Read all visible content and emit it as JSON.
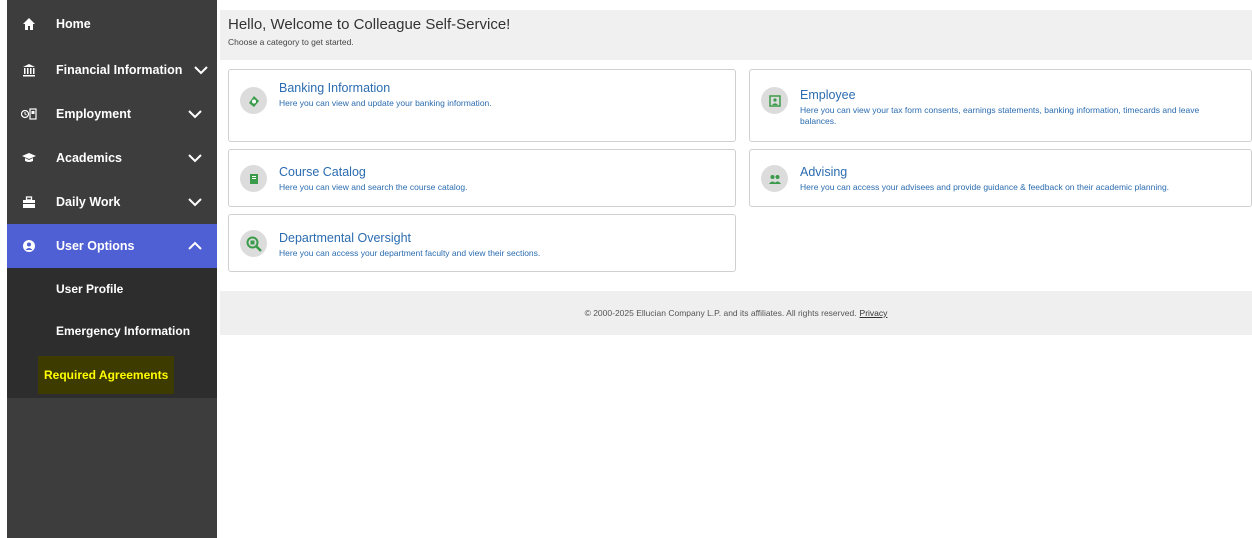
{
  "sidebar": {
    "home": {
      "label": "Home",
      "icon": "home-icon"
    },
    "items": [
      {
        "label": "Financial Information",
        "icon": "bank-icon"
      },
      {
        "label": "Employment",
        "icon": "id-card-icon"
      },
      {
        "label": "Academics",
        "icon": "graduation-cap-icon"
      },
      {
        "label": "Daily Work",
        "icon": "briefcase-icon"
      },
      {
        "label": "User Options",
        "icon": "user-icon"
      }
    ],
    "submenu": [
      {
        "label": "User Profile"
      },
      {
        "label": "Emergency Information"
      },
      {
        "label": "Required Agreements"
      }
    ],
    "active_color": "#4f5fd4",
    "highlight_color": "#ffff00"
  },
  "header": {
    "title": "Hello, Welcome to Colleague Self-Service!",
    "subtitle": "Choose a category to get started."
  },
  "cards": [
    {
      "title": "Banking Information",
      "desc": "Here you can view and update your banking information.",
      "icon": "banking-icon"
    },
    {
      "title": "Employee",
      "desc": "Here you can view your tax form consents, earnings statements, banking information, timecards and leave balances.",
      "icon": "employee-icon"
    },
    {
      "title": "Course Catalog",
      "desc": "Here you can view and search the course catalog.",
      "icon": "book-icon"
    },
    {
      "title": "Advising",
      "desc": "Here you can access your advisees and provide guidance & feedback on their academic planning.",
      "icon": "people-icon"
    },
    {
      "title": "Departmental Oversight",
      "desc": "Here you can access your department faculty and view their sections.",
      "icon": "magnifier-icon"
    }
  ],
  "footer": {
    "text": "© 2000-2025 Ellucian Company L.P. and its affiliates. All rights reserved.",
    "privacy": "Privacy"
  }
}
